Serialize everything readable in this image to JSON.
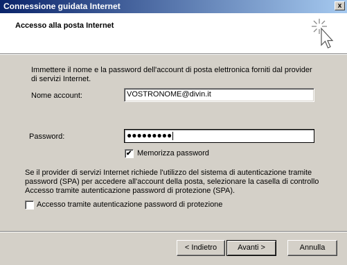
{
  "window": {
    "title": "Connessione guidata Internet",
    "close_glyph": "x"
  },
  "header": {
    "title": "Accesso alla posta Internet",
    "icon": "wizard-cursor-icon"
  },
  "intro": "Immettere il nome e la password dell'account di posta elettronica forniti dal provider di servizi Internet.",
  "account": {
    "label": "Nome account:",
    "value": "VOSTRONOME@divin.it"
  },
  "password": {
    "label": "Password:",
    "masked_value": "●●●●●●●●●"
  },
  "remember": {
    "label": "Memorizza password",
    "checked": true,
    "mark": "✔"
  },
  "spa_info": "Se il provider di servizi Internet richiede l'utilizzo del sistema di autenticazione tramite password (SPA) per accedere all'account della posta, selezionare la casella di controllo Accesso tramite autenticazione password di protezione (SPA).",
  "spa": {
    "label": "Accesso tramite autenticazione password di protezione",
    "checked": false
  },
  "buttons": {
    "back": "< Indietro",
    "next": "Avanti >",
    "cancel": "Annulla"
  }
}
